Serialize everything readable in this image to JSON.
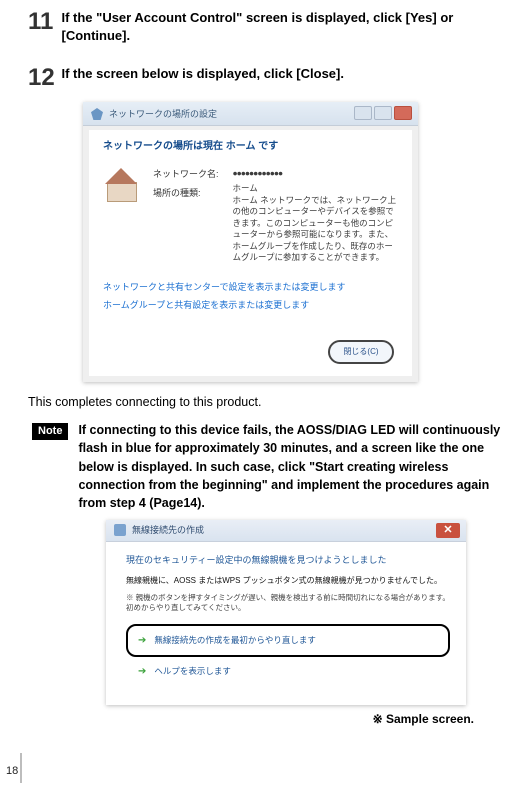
{
  "steps": {
    "s11": {
      "num": "11",
      "text": "If the \"User Account Control\" screen is displayed, click [Yes] or [Continue]."
    },
    "s12": {
      "num": "12",
      "text": "If the screen below is displayed, click [Close]."
    }
  },
  "dlg1": {
    "title": "ネットワークの場所の設定",
    "heading": "ネットワークの場所は現在 ホーム です",
    "label_netname": "ネットワーク名:",
    "label_loc": "場所の種類:",
    "dots": "●●●●●●●●●●●●",
    "val_loc": "ホーム",
    "desc": "ホーム ネットワークでは、ネットワーク上の他のコンピューターやデバイスを参照できます。このコンピューターも他のコンピューターから参照可能になります。また、ホームグループを作成したり、既存のホームグループに参加することができます。",
    "link1": "ネットワークと共有センターで設定を表示または変更します",
    "link2": "ホームグループと共有設定を表示または変更します",
    "close_btn": "閉じる(C)"
  },
  "completes": "This completes connecting to this product.",
  "note": {
    "badge": "Note",
    "text": "If connecting to this device fails, the AOSS/DIAG LED will continuously flash in blue for approximately 30 minutes, and a screen like the one below is displayed. In such case, click \"Start creating wireless connection from the beginning\" and implement the procedures again from step 4 (Page14)."
  },
  "dlg2": {
    "title": "無線接続先の作成",
    "line1": "現在のセキュリティー設定中の無線親機を見つけようとしました",
    "line2": "無線親機に、AOSS またはWPS プッシュボタン式の無線親機が見つかりませんでした。",
    "line3": "※ 親機のボタンを押すタイミングが遅い、親機を検出する前に時間切れになる場合があります。初めからやり直してみてください。",
    "boxrow": "無線接続先の作成を最初からやり直します",
    "help": "ヘルプを表示します"
  },
  "sample": "※ Sample screen.",
  "page_number": "18"
}
